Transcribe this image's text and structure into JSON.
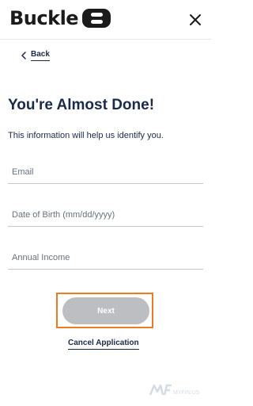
{
  "header": {
    "logo_text": "Buckle",
    "close_icon": "close-icon"
  },
  "nav": {
    "back_label": "Back",
    "back_icon": "chevron-left-icon"
  },
  "main": {
    "title": "You're Almost Done!",
    "subtitle": "This information will help us identify you."
  },
  "form": {
    "email_placeholder": "Email",
    "dob_placeholder": "Date of Birth (mm/dd/yyyy)",
    "income_placeholder": "Annual Income",
    "next_label": "Next",
    "cancel_label": "Cancel Application"
  },
  "watermark": {
    "text": "MYFIN.US"
  },
  "colors": {
    "text_navy": "#1a2a4a",
    "button_disabled": "#bcbec2",
    "highlight_orange": "#f07a22",
    "divider": "#c8c8c8"
  }
}
